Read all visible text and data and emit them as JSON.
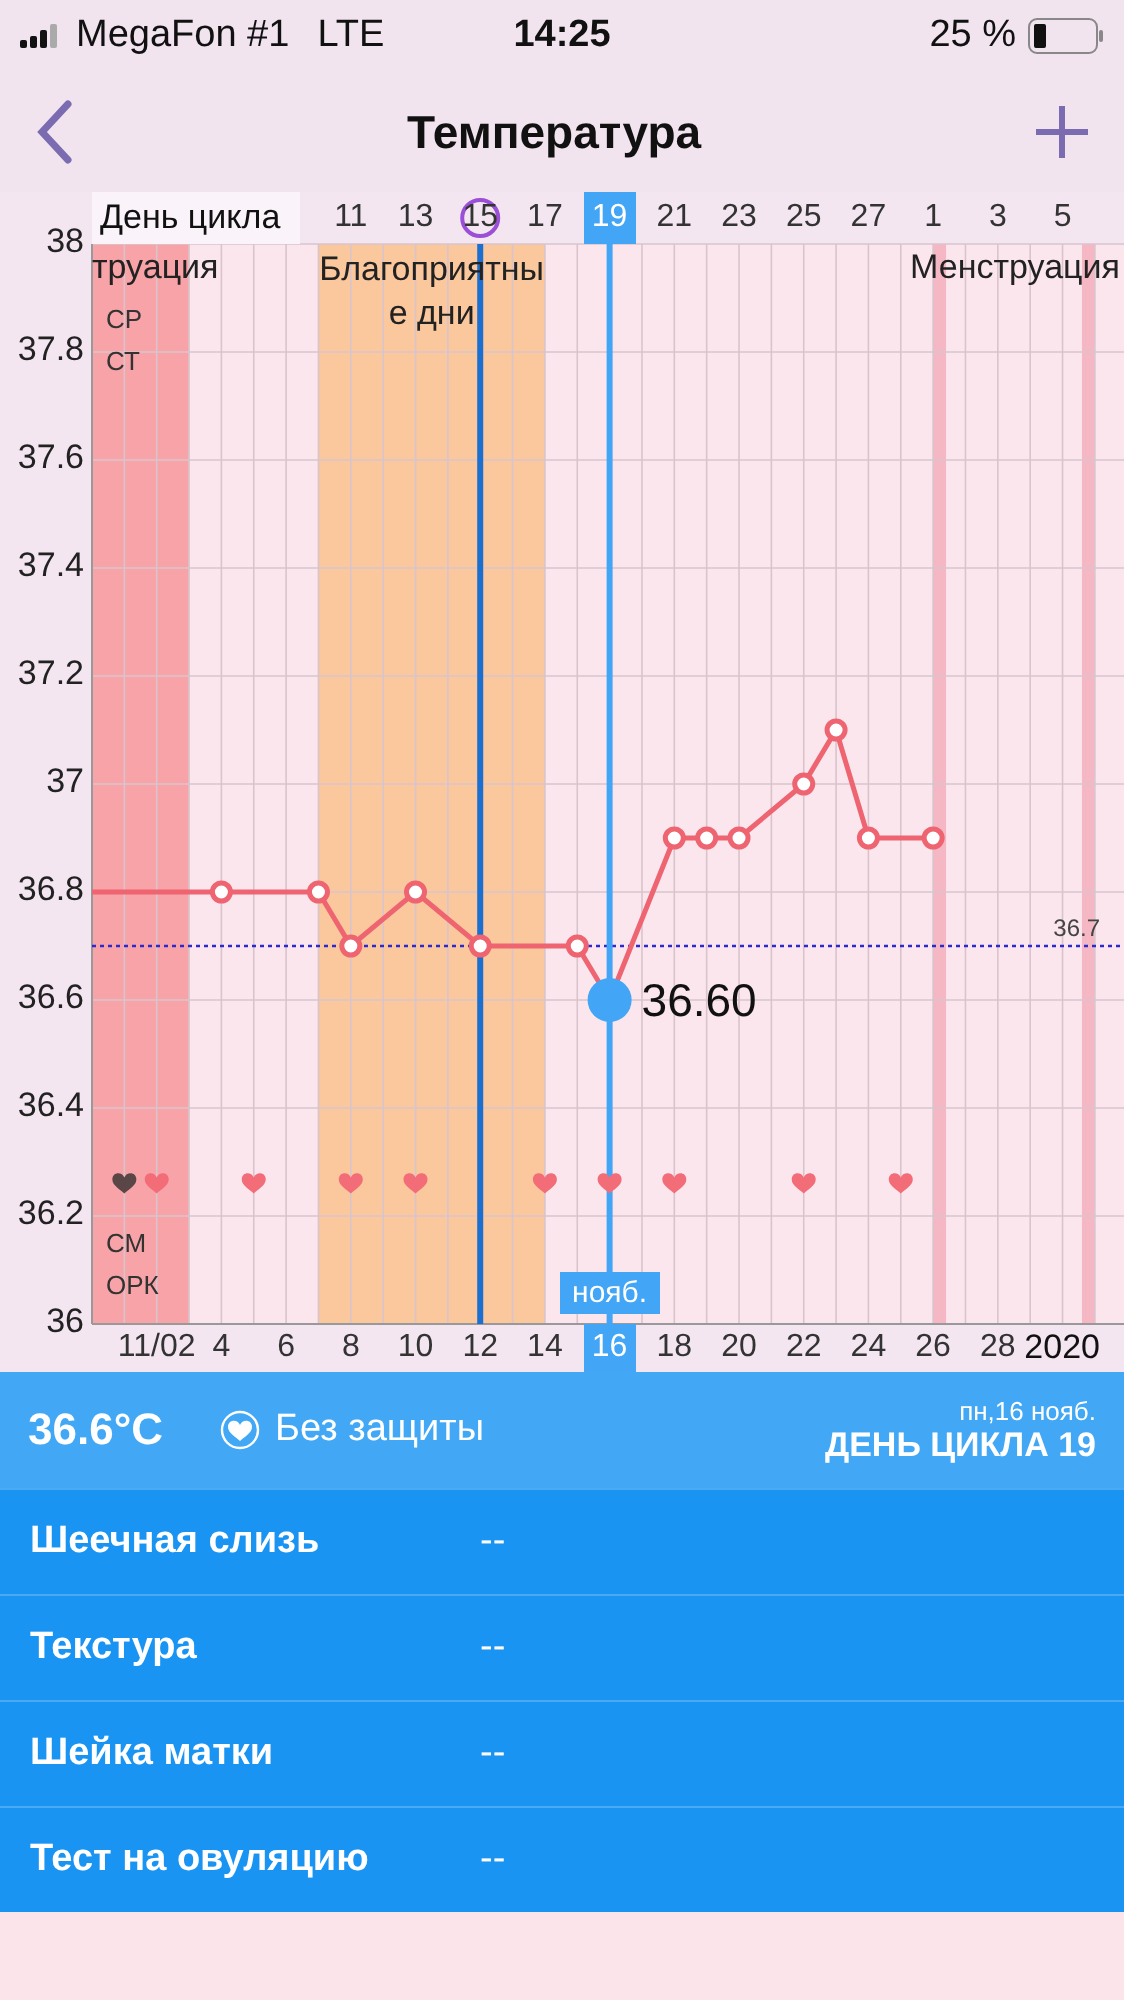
{
  "status_bar": {
    "carrier": "MegaFon #1",
    "network": "LTE",
    "time": "14:25",
    "battery": "25 %"
  },
  "nav": {
    "title": "Температура"
  },
  "chart": {
    "cycle_label": "День цикла",
    "cycle_days": [
      {
        "label": "11",
        "selected": false,
        "marked": false
      },
      {
        "label": "13",
        "selected": false,
        "marked": false
      },
      {
        "label": "15",
        "selected": false,
        "marked": true
      },
      {
        "label": "17",
        "selected": false,
        "marked": false
      },
      {
        "label": "19",
        "selected": true,
        "marked": false
      },
      {
        "label": "21",
        "selected": false,
        "marked": false
      },
      {
        "label": "23",
        "selected": false,
        "marked": false
      },
      {
        "label": "25",
        "selected": false,
        "marked": false
      },
      {
        "label": "27",
        "selected": false,
        "marked": false
      },
      {
        "label": "1",
        "selected": false,
        "marked": false
      },
      {
        "label": "3",
        "selected": false,
        "marked": false
      },
      {
        "label": "5",
        "selected": false,
        "marked": false
      }
    ],
    "row_labels": [
      "СР",
      "СТ",
      "СМ",
      "ОРК"
    ],
    "heart_days": [
      {
        "kind": "heart",
        "color": "#5a4646"
      },
      {
        "kind": "heart",
        "color": "#f26d78"
      },
      {
        "kind": "empty"
      },
      {
        "kind": "empty"
      },
      {
        "kind": "heart",
        "color": "#f26d78"
      },
      {
        "kind": "empty"
      },
      {
        "kind": "empty"
      },
      {
        "kind": "heart",
        "color": "#f26d78"
      },
      {
        "kind": "empty"
      },
      {
        "kind": "heart",
        "color": "#f26d78"
      },
      {
        "kind": "empty"
      },
      {
        "kind": "empty"
      },
      {
        "kind": "empty"
      },
      {
        "kind": "heart",
        "color": "#f26d78"
      },
      {
        "kind": "empty"
      },
      {
        "kind": "heart",
        "color": "#f26d78"
      },
      {
        "kind": "empty"
      },
      {
        "kind": "heart",
        "color": "#f26d78"
      },
      {
        "kind": "empty"
      },
      {
        "kind": "empty"
      },
      {
        "kind": "empty"
      },
      {
        "kind": "heart",
        "color": "#f26d78"
      },
      {
        "kind": "empty"
      },
      {
        "kind": "empty"
      },
      {
        "kind": "heart",
        "color": "#f26d78"
      }
    ],
    "year_label": "2020",
    "selection": {
      "value_label": "36.60",
      "month_label": "нояб."
    },
    "chart_data": {
      "type": "line",
      "grid": true,
      "x": [
        0,
        4,
        7,
        8,
        10,
        12,
        15,
        16,
        18,
        19,
        20,
        22,
        23,
        24,
        26
      ],
      "series": [
        {
          "color": "#ee6470",
          "marker": "o",
          "values": [
            36.8,
            36.8,
            36.8,
            36.7,
            36.8,
            36.7,
            36.7,
            36.6,
            36.9,
            36.9,
            36.9,
            37.0,
            37.1,
            36.9,
            36.9
          ]
        }
      ],
      "ylim": [
        36,
        38
      ],
      "xlim": [
        0,
        31.9
      ],
      "yticks": [
        36,
        36.2,
        36.4,
        36.6,
        36.8,
        37,
        37.2,
        37.4,
        37.6,
        37.8,
        38
      ],
      "xticks": [
        {
          "value": 2,
          "label": "11/02"
        },
        4,
        6,
        8,
        10,
        12,
        14,
        16,
        18,
        20,
        22,
        24,
        26,
        28
      ],
      "bands": [
        {
          "axis": "x",
          "from": 0,
          "to": 3,
          "color": "#f7a3a8",
          "label": "труация"
        },
        {
          "axis": "x",
          "from": 7,
          "to": 14,
          "color": "#fbc79c",
          "label": "Благоприятные дни"
        },
        {
          "axis": "x",
          "from": 26,
          "to": 26.4,
          "color": "#f5b7c4",
          "label": "Менструация"
        },
        {
          "axis": "x",
          "from": 30.6,
          "to": 31,
          "color": "#f5b7c4"
        }
      ],
      "ref_lines": [
        {
          "axis": "y",
          "value": 36.7,
          "color": "#2a2ad0",
          "label": "36.7"
        },
        {
          "axis": "x",
          "value": 12,
          "color": "#1a6fd0"
        },
        {
          "axis": "x",
          "value": 16,
          "color": "#42a5f5"
        }
      ]
    }
  },
  "summary": {
    "temperature": "36.6°C",
    "protection": "Без защиты",
    "date": "пн,16 нояб.",
    "cycle_day": "ДЕНЬ ЦИКЛА 19"
  },
  "details": [
    {
      "label": "Шеечная слизь",
      "value": "--"
    },
    {
      "label": "Текстура",
      "value": "--"
    },
    {
      "label": "Шейка матки",
      "value": "--"
    },
    {
      "label": "Тест на овуляцию",
      "value": "--"
    }
  ]
}
